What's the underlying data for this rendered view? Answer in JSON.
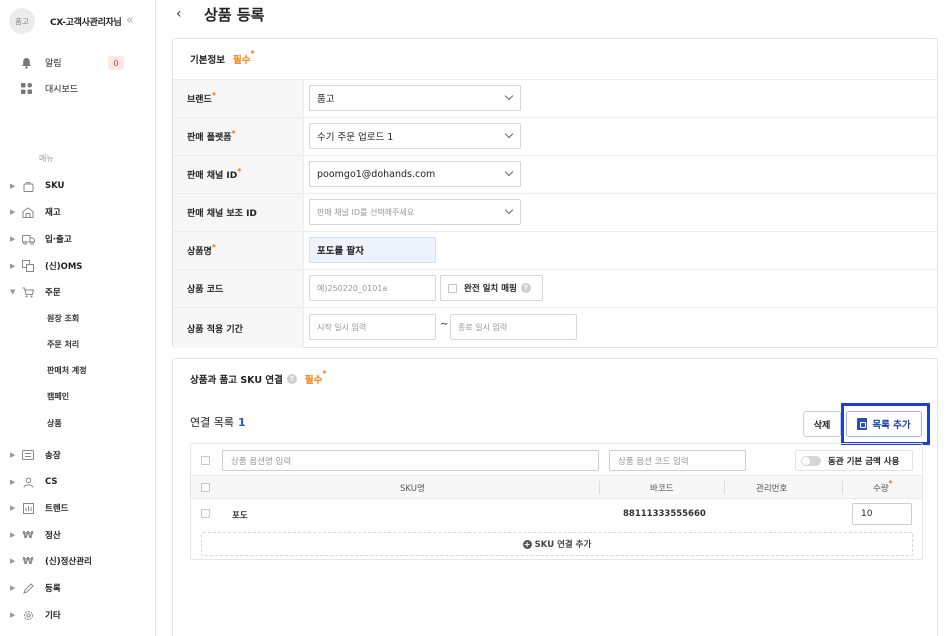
{
  "sidebar": {
    "avatar_text": "품고",
    "org_name": "CX-고객사관리자님",
    "collapse_icon": "double-chevron-left-icon",
    "top_items": [
      {
        "label": "알림",
        "icon": "bell-icon",
        "badge": "0"
      },
      {
        "label": "대시보드",
        "icon": "dashboard-icon"
      }
    ],
    "menu_heading": "메뉴",
    "menu": [
      {
        "label": "SKU",
        "icon": "bag-icon",
        "expanded": false
      },
      {
        "label": "재고",
        "icon": "warehouse-icon",
        "expanded": false
      },
      {
        "label": "입·출고",
        "icon": "truck-icon",
        "expanded": false
      },
      {
        "label": "(신)OMS",
        "icon": "oms-icon",
        "expanded": false
      },
      {
        "label": "주문",
        "icon": "cart-icon",
        "expanded": true
      },
      {
        "label": "송장",
        "icon": "invoice-icon",
        "expanded": false
      },
      {
        "label": "CS",
        "icon": "person-icon",
        "expanded": false
      },
      {
        "label": "트렌드",
        "icon": "chart-icon",
        "expanded": false
      },
      {
        "label": "정산",
        "icon": "won-icon",
        "expanded": false
      },
      {
        "label": "(신)정산관리",
        "icon": "won-icon",
        "expanded": false
      },
      {
        "label": "등록",
        "icon": "pencil-icon",
        "expanded": false
      },
      {
        "label": "기타",
        "icon": "gear-icon",
        "expanded": false
      }
    ],
    "order_subitems": [
      "원장 조회",
      "주문 처리",
      "판매처 계정",
      "캠페인",
      "상품"
    ]
  },
  "page": {
    "back_icon": "chevron-left-icon",
    "title": "상품 등록"
  },
  "basic_info": {
    "header": "기본정보",
    "required_tag": "필수",
    "required_mark": "*",
    "rows": [
      {
        "label": "브랜드",
        "required": true,
        "value": "품고",
        "type": "select"
      },
      {
        "label": "판매 플랫폼",
        "required": true,
        "value": "수기 주문 업로드 1",
        "type": "select"
      },
      {
        "label": "판매 채널 ID",
        "required": true,
        "value": "poomgo1@dohands.com",
        "type": "select"
      },
      {
        "label": "판매 채널 보조 ID",
        "required": false,
        "placeholder": "판매 채널 ID를 선택해주세요",
        "type": "select"
      },
      {
        "label": "상품명",
        "required": true,
        "value": "포도를 팔자",
        "type": "text"
      },
      {
        "label": "상품 코드",
        "required": false,
        "placeholder": "예)250220_0101a",
        "type": "text"
      },
      {
        "label": "상품 적용 기간",
        "required": false,
        "type": "range"
      }
    ],
    "exact_match_label": "완전 일치 매핑",
    "period_start_placeholder": "시작 일시 입력",
    "period_separator": "~",
    "period_end_placeholder": "종료 일시 입력"
  },
  "sku_link": {
    "header": "상품과 품고 SKU 연결",
    "required_tag": "필수",
    "list_label": "연결 목록",
    "list_count": "1",
    "delete_label": "삭제",
    "add_label": "목록 추가",
    "option_name_placeholder": "상품 옵션명 입력",
    "option_code_placeholder": "상품 옵션 코드 입력",
    "toggle_label": "동관 기본 금액 사용",
    "columns": [
      "SKU명",
      "바코드",
      "관리번호",
      "수량"
    ],
    "rows": [
      {
        "sku_name": "포도",
        "barcode": "88111333555660",
        "manage_no": "",
        "qty": "10"
      }
    ],
    "add_sku_label": "SKU 연결 추가"
  }
}
